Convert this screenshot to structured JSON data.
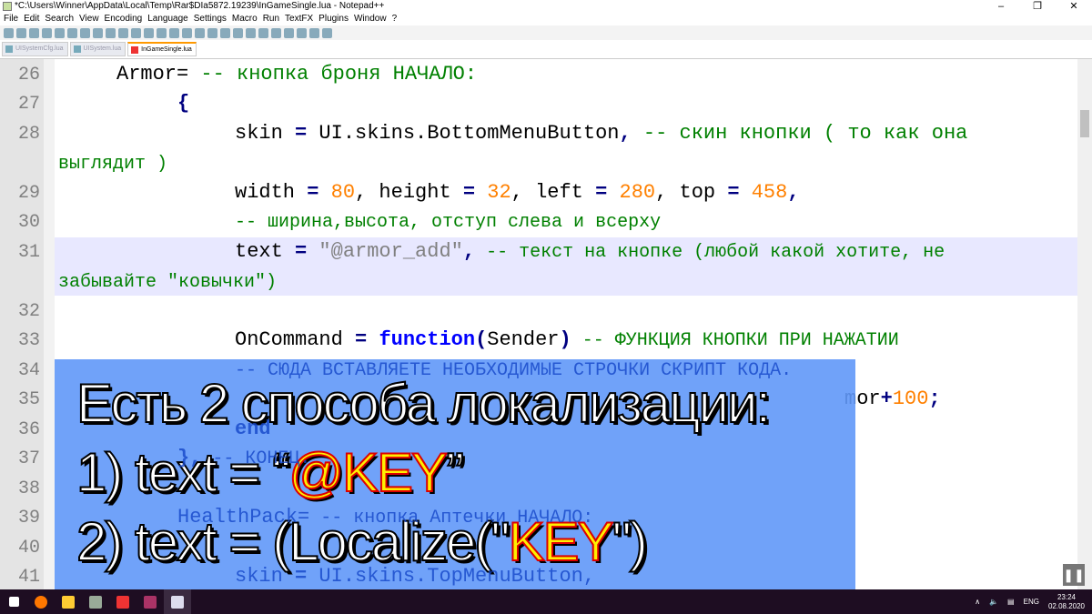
{
  "window": {
    "title": "*C:\\Users\\Winner\\AppData\\Local\\Temp\\Rar$DIa5872.19239\\InGameSingle.lua - Notepad++"
  },
  "menu": [
    "File",
    "Edit",
    "Search",
    "View",
    "Encoding",
    "Language",
    "Settings",
    "Macro",
    "Run",
    "TextFX",
    "Plugins",
    "Window",
    "?"
  ],
  "tabs": [
    {
      "label": "UISystemCfg.lua"
    },
    {
      "label": "UISystem.lua"
    },
    {
      "label": "InGameSingle.lua",
      "active": true
    }
  ],
  "editor": {
    "line_numbers": [
      "26",
      "27",
      "28",
      "29",
      "30",
      "31",
      "32",
      "33",
      "34",
      "35",
      "36",
      "37",
      "38",
      "39",
      "40",
      "41"
    ],
    "lines": {
      "l26": {
        "a": "Armor=",
        "b": " -- кнопка броня НАЧАЛО:"
      },
      "l27": "{",
      "l28": {
        "a": "skin",
        "b": "=",
        "c": "UI.skins.BottomMenuButton",
        "d": ",",
        "e": " -- скин кнопки ( то как она",
        "f": "выглядит )"
      },
      "l29": {
        "a": "width",
        "b": "=",
        "c": "80",
        "d": ", height ",
        "e": "32",
        "f": ", left ",
        "g": "280",
        "h": ", top ",
        "i": "458",
        "j": ","
      },
      "l30": "-- ширина,высота, отступ слева и всерху",
      "l31": {
        "a": "text",
        "b": "=",
        "c": "\"@armor_add\"",
        "d": ",",
        "e": " -- текст на кнопке (любой какой хотите, не",
        "f": "забывайте \"ковычки\")"
      },
      "l33": {
        "a": "OnCommand",
        "b": "=",
        "c": "function",
        "d": "(",
        "e": "Sender",
        "f": ")",
        "g": " -- ФУНКЦИЯ КНОПКИ ПРИ НАЖАТИИ"
      },
      "l34": "-- СЮДА ВСТАВЛЯЕТЕ НЕОБХОДИМЫЕ СТРОЧКИ СКРИПТ КОДА.",
      "l35": {
        "a": "mor",
        "b": "+",
        "c": "100",
        "d": ";"
      },
      "l36": "end",
      "l37": {
        "a": "},",
        "b": " -- КОНЕЦ."
      },
      "l39": {
        "a": "HealthPack=",
        "b": " -- кнопка Аптечки НАЧАЛО:"
      },
      "l41": {
        "a": "skin",
        "b": "=",
        "c": "UI.skins.TopMenuButton,"
      }
    }
  },
  "overlay": {
    "line1": "Есть 2 способа локализации:",
    "line2_pre": "1) text = “",
    "line2_key": "@KEY",
    "line2_post": "”",
    "line3_pre": "2) text = (Localize(\"",
    "line3_key": "KEY",
    "line3_post": "\")"
  },
  "taskbar": {
    "lang": "ENG",
    "time": "23:24",
    "date": "02.08.2020"
  },
  "colors": {
    "overlay": "#6098f8",
    "keyword": "#0000ff",
    "number": "#ff8000",
    "comment": "#008000",
    "taskbar": "#1e0d22"
  }
}
